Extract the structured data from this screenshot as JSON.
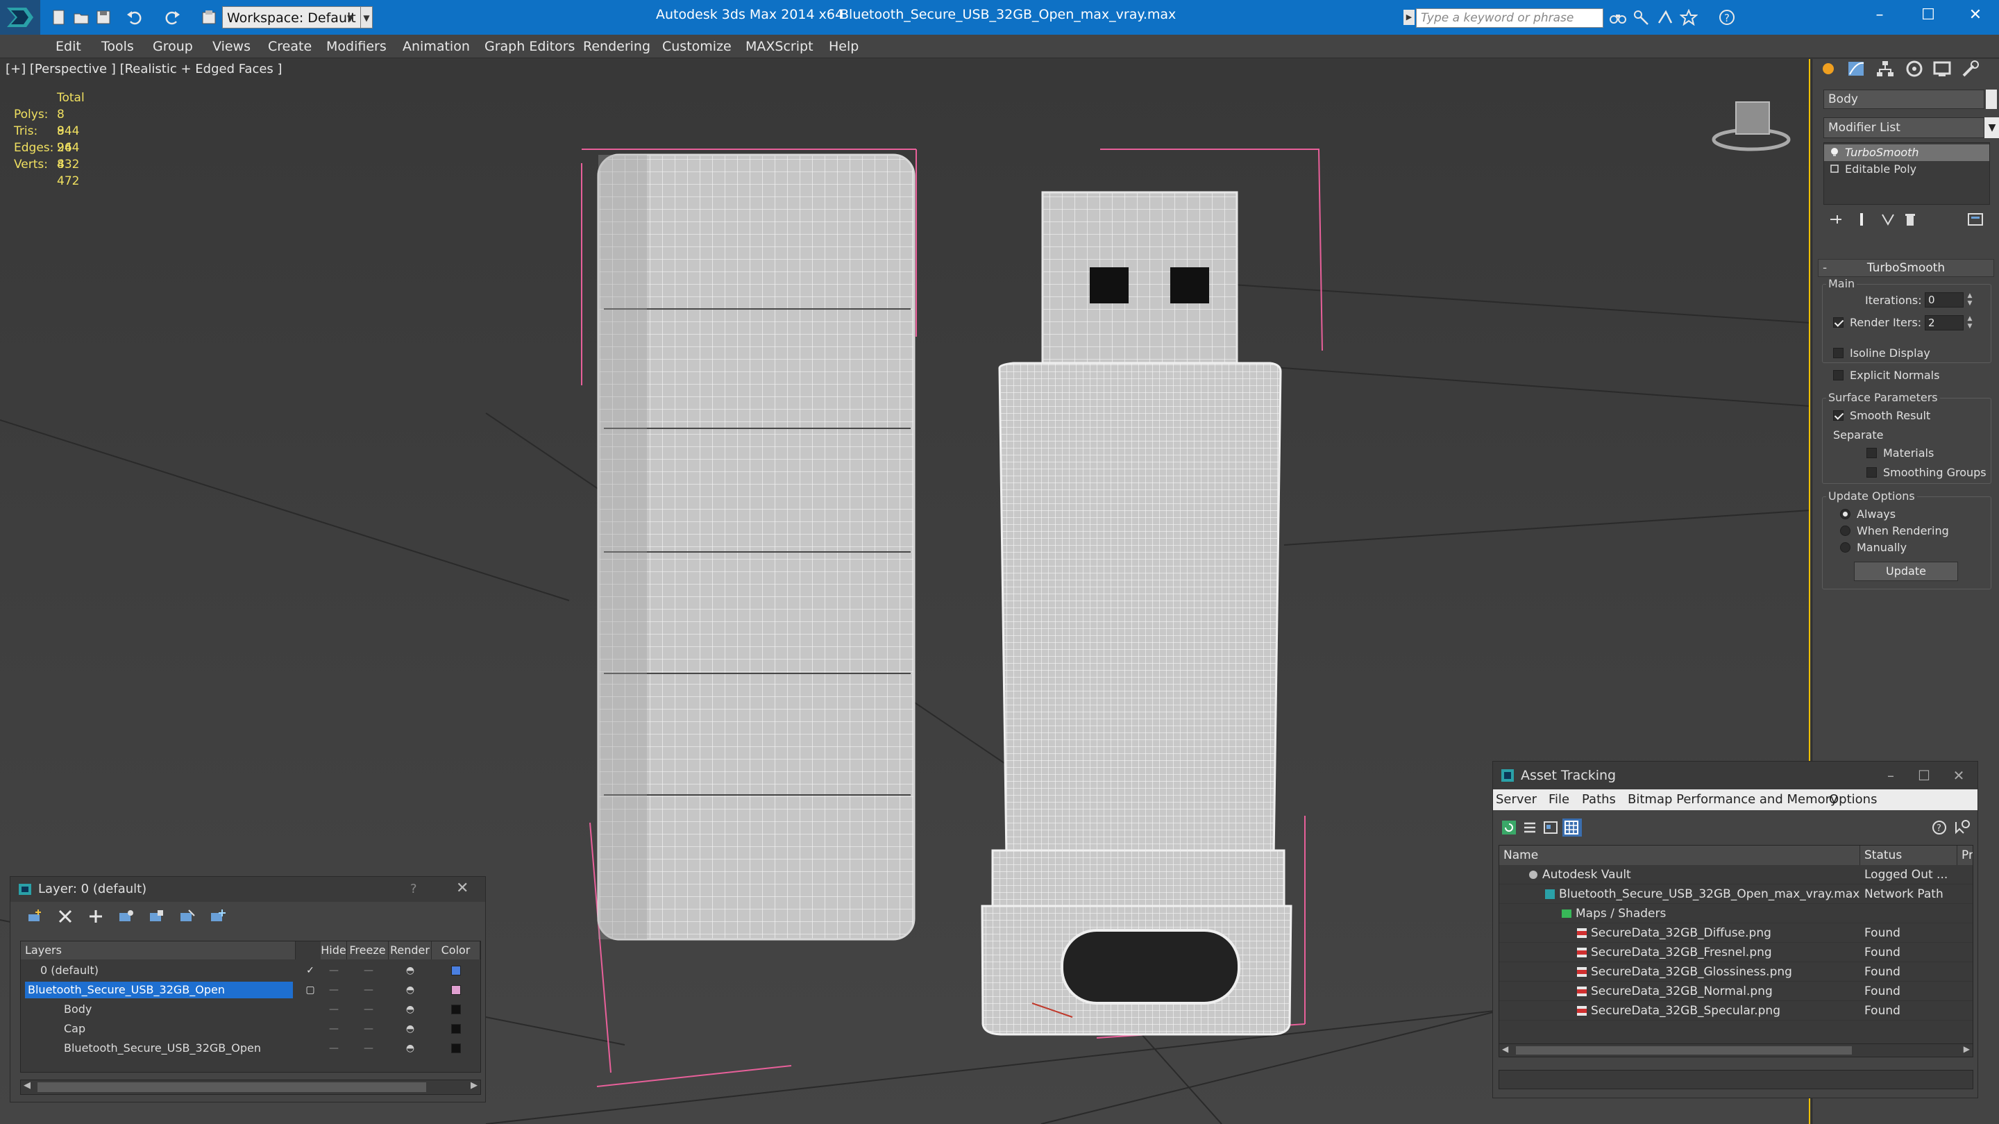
{
  "titlebar": {
    "workspace": "Workspace: Default",
    "app_name": "Autodesk 3ds Max  2014 x64",
    "file_name": "Bluetooth_Secure_USB_32GB_Open_max_vray.max",
    "search_placeholder": "Type a keyword or phrase"
  },
  "menu": [
    "Edit",
    "Tools",
    "Group",
    "Views",
    "Create",
    "Modifiers",
    "Animation",
    "Graph Editors",
    "Rendering",
    "Customize",
    "MAXScript",
    "Help"
  ],
  "viewport": {
    "label": "[+] [Perspective ] [Realistic + Edged Faces ]",
    "stats_header": "Total",
    "stats": [
      {
        "name": "Polys:",
        "value": "8 944"
      },
      {
        "name": "Tris:",
        "value": "8 944"
      },
      {
        "name": "Edges:",
        "value": "26 832"
      },
      {
        "name": "Verts:",
        "value": "4 472"
      }
    ]
  },
  "command_panel": {
    "object_name": "Body",
    "modifier_list": "Modifier List",
    "stack": [
      "TurboSmooth",
      "Editable Poly"
    ],
    "rollout_title": "TurboSmooth",
    "main_group": "Main",
    "iterations_label": "Iterations:",
    "iterations_value": "0",
    "render_iters_label": "Render Iters:",
    "render_iters_value": "2",
    "isoline_label": "Isoline Display",
    "explicit_normals_label": "Explicit Normals",
    "surface_group": "Surface Parameters",
    "smooth_result_label": "Smooth Result",
    "separate_label": "Separate",
    "materials_label": "Materials",
    "smoothing_groups_label": "Smoothing Groups",
    "update_group": "Update Options",
    "always_label": "Always",
    "when_rendering_label": "When Rendering",
    "manually_label": "Manually",
    "update_button": "Update"
  },
  "layer_dialog": {
    "title": "Layer: 0 (default)",
    "help": "?",
    "headers": {
      "layers": "Layers",
      "hide": "Hide",
      "freeze": "Freeze",
      "render": "Render",
      "color": "Color"
    },
    "rows": [
      {
        "name": "0 (default)",
        "color": "#4a7fe0"
      },
      {
        "name": "Bluetooth_Secure_USB_32GB_Open",
        "color": "#e0a0d0"
      },
      {
        "name": "Body",
        "color": "#111111"
      },
      {
        "name": "Cap",
        "color": "#111111"
      },
      {
        "name": "Bluetooth_Secure_USB_32GB_Open",
        "color": "#111111"
      }
    ]
  },
  "asset_dialog": {
    "title": "Asset Tracking",
    "menu": [
      "Server",
      "File",
      "Paths",
      "Bitmap Performance and Memory",
      "Options"
    ],
    "headers": {
      "name": "Name",
      "status": "Status",
      "extra": "Pro"
    },
    "rows": [
      {
        "name": "Autodesk Vault",
        "status": "Logged Out ..."
      },
      {
        "name": "Bluetooth_Secure_USB_32GB_Open_max_vray.max",
        "status": "Network Path"
      },
      {
        "name": "Maps / Shaders",
        "status": ""
      },
      {
        "name": "SecureData_32GB_Diffuse.png",
        "status": "Found"
      },
      {
        "name": "SecureData_32GB_Fresnel.png",
        "status": "Found"
      },
      {
        "name": "SecureData_32GB_Glossiness.png",
        "status": "Found"
      },
      {
        "name": "SecureData_32GB_Normal.png",
        "status": "Found"
      },
      {
        "name": "SecureData_32GB_Specular.png",
        "status": "Found"
      }
    ]
  }
}
